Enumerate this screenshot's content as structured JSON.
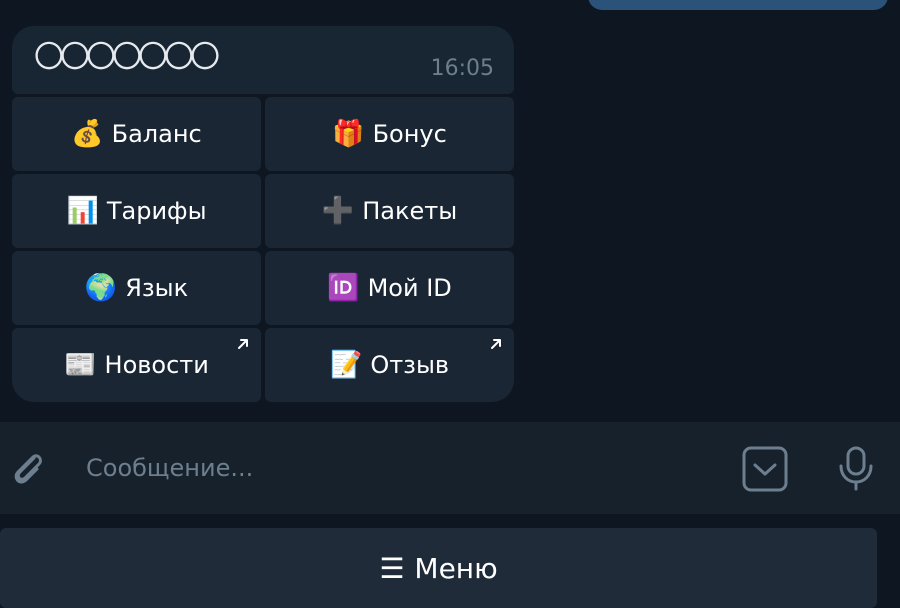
{
  "message": {
    "text": "〇〇〇〇〇〇〇",
    "time": "16:05"
  },
  "keyboard": {
    "buttons": [
      {
        "emoji": "💰",
        "label": "Баланс"
      },
      {
        "emoji": "🎁",
        "label": "Бонус"
      },
      {
        "emoji": "📊",
        "label": "Тарифы"
      },
      {
        "emoji": "➕",
        "label": "Пакеты"
      },
      {
        "emoji": "🌍",
        "label": "Язык"
      },
      {
        "emoji": "🆔",
        "label": "Мой ID"
      },
      {
        "emoji": "📰",
        "label": "Новости",
        "external": true
      },
      {
        "emoji": "📝",
        "label": "Отзыв",
        "external": true
      }
    ]
  },
  "input": {
    "placeholder": "Сообщение..."
  },
  "menu": {
    "glyph": "☰",
    "label": "Меню"
  },
  "icons": {
    "attach": "paperclip-icon",
    "keyboard_toggle": "keyboard-toggle-icon",
    "mic": "microphone-icon",
    "external": "external-link-arrow-icon"
  },
  "colors": {
    "background": "#0e1621",
    "bubble": "#182533",
    "button": "#1a2634",
    "input_bar": "#17212b",
    "outgoing": "#2b5278",
    "muted_text": "#6d7f8f"
  }
}
